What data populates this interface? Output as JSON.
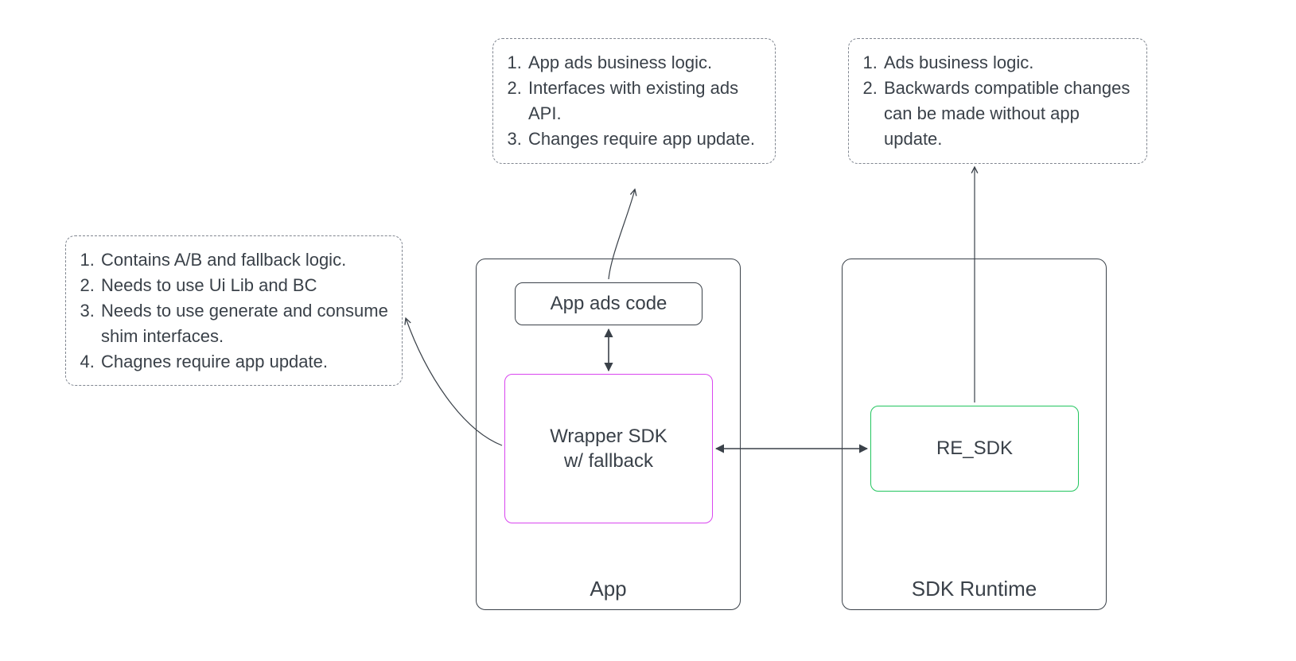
{
  "notes": {
    "top_center": {
      "items": [
        "App ads business logic.",
        "Interfaces with existing ads API.",
        "Changes require app update."
      ]
    },
    "top_right": {
      "items": [
        "Ads business logic.",
        "Backwards compatible changes can be made without app update."
      ]
    },
    "left": {
      "items": [
        "Contains A/B and fallback logic.",
        "Needs to use Ui Lib and BC",
        "Needs to use generate and consume shim interfaces.",
        "Chagnes require app update."
      ]
    }
  },
  "containers": {
    "app": {
      "label": "App"
    },
    "sdk_runtime": {
      "label": "SDK Runtime"
    }
  },
  "nodes": {
    "app_ads_code": {
      "label": "App ads code"
    },
    "wrapper_sdk": {
      "label_line1": "Wrapper SDK",
      "label_line2": "w/ fallback"
    },
    "re_sdk": {
      "label": "RE_SDK"
    }
  },
  "colors": {
    "stroke": "#3a4149",
    "magenta": "#d946ef",
    "green": "#22c55e"
  }
}
